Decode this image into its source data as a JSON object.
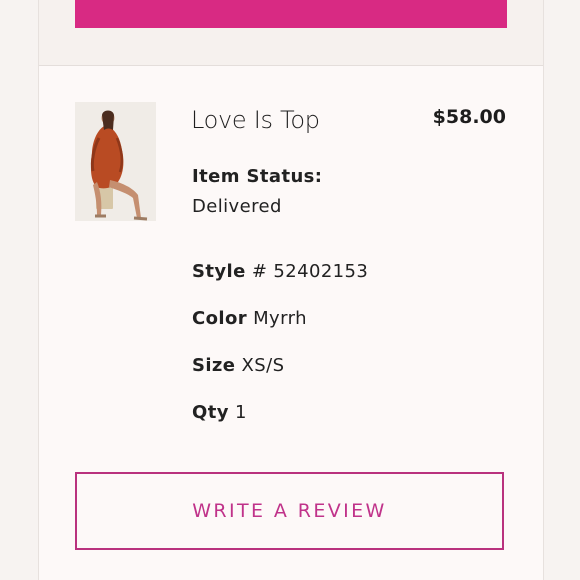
{
  "product": {
    "title": "Love Is Top",
    "price": "$58.00",
    "thumbnail_icon": "product-photo"
  },
  "status": {
    "label": "Item Status:",
    "value": "Delivered"
  },
  "details": {
    "style_label": "Style",
    "style_value": "# 52402153",
    "color_label": "Color",
    "color_value": "Myrrh",
    "size_label": "Size",
    "size_value": "XS/S",
    "qty_label": "Qty",
    "qty_value": "1"
  },
  "actions": {
    "review_label": "WRITE A REVIEW"
  },
  "colors": {
    "accent": "#d82a83",
    "review_border": "#b9327e"
  }
}
